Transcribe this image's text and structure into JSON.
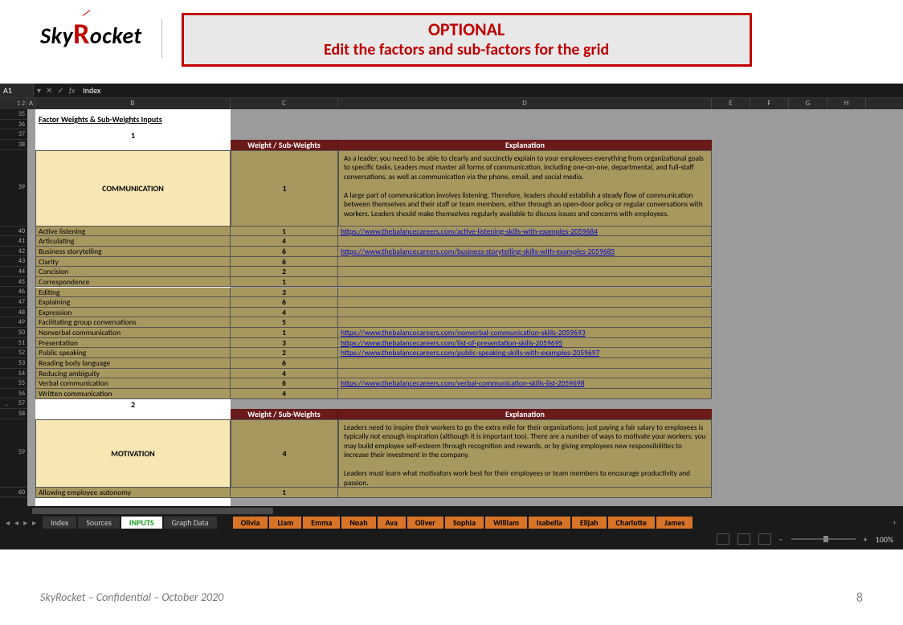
{
  "brand": "SkyRocket",
  "banner": {
    "line1": "OPTIONAL",
    "line2": "Edit the factors and sub-factors for the grid"
  },
  "excel": {
    "cellref": "A1",
    "fx_value": "Index",
    "cols": [
      "A",
      "B",
      "C",
      "D",
      "E",
      "F",
      "G",
      "H"
    ],
    "row_start": 35,
    "section_title": "Factor Weights & Sub-Weights Inputs",
    "header_weight": "Weight / Sub-Weights",
    "header_explain": "Explanation",
    "sections": [
      {
        "num": "1",
        "name": "COMMUNICATION",
        "weight": "1",
        "explain": "As a leader, you need to be able to clearly and succinctly explain to your employees everything from organizational goals to specific tasks. Leaders must master all forms of communication, including one-on-one, departmental, and full-staff conversations, as well as communication via the phone, email, and social media.\n\nA large part of communication involves listening. Therefore, leaders should establish a steady flow of communication between themselves and their staff or team members, either through an open-door policy or regular conversations with workers. Leaders should make themselves regularly available to discuss issues and concerns with employees.",
        "rows": [
          {
            "r": 40,
            "label": "Active listening",
            "w": "1",
            "link": "https://www.thebalancecareers.com/active-listening-skills-with-examples-2059684"
          },
          {
            "r": 41,
            "label": "Articulating",
            "w": "4",
            "link": ""
          },
          {
            "r": 42,
            "label": "Business storytelling",
            "w": "6",
            "link": "https://www.thebalancecareers.com/business-storytelling-skills-with-examples-2059685"
          },
          {
            "r": 43,
            "label": "Clarity",
            "w": "6",
            "link": ""
          },
          {
            "r": 44,
            "label": "Concision",
            "w": "2",
            "link": ""
          },
          {
            "r": 45,
            "label": "Correspondence",
            "w": "1",
            "link": ""
          },
          {
            "r": 46,
            "label": "Editing",
            "w": "3",
            "link": ""
          },
          {
            "r": 47,
            "label": "Explaining",
            "w": "6",
            "link": ""
          },
          {
            "r": 48,
            "label": "Expression",
            "w": "4",
            "link": ""
          },
          {
            "r": 49,
            "label": "Facilitating group conversations",
            "w": "5",
            "link": ""
          },
          {
            "r": 50,
            "label": "Nonverbal communication",
            "w": "1",
            "link": "https://www.thebalancecareers.com/nonverbal-communication-skills-2059693"
          },
          {
            "r": 51,
            "label": "Presentation",
            "w": "3",
            "link": "https://www.thebalancecareers.com/list-of-presentation-skills-2059695"
          },
          {
            "r": 52,
            "label": "Public speaking",
            "w": "2",
            "link": "https://www.thebalancecareers.com/public-speaking-skills-with-examples-2059697"
          },
          {
            "r": 53,
            "label": "Reading body language",
            "w": "6",
            "link": ""
          },
          {
            "r": 54,
            "label": "Reducing ambiguity",
            "w": "4",
            "link": ""
          },
          {
            "r": 55,
            "label": "Verbal communication",
            "w": "6",
            "link": "https://www.thebalancecareers.com/verbal-communication-skills-list-2059698"
          },
          {
            "r": 56,
            "label": "Written communication",
            "w": "4",
            "link": ""
          }
        ]
      },
      {
        "num": "2",
        "name": "MOTIVATION",
        "weight": "4",
        "explain": "Leaders need to inspire their workers to go the extra mile for their organizations; just paying a fair salary to employees is typically not enough inspiration (although it is important too). There are a number of ways to motivate your workers: you may build employee self-esteem through recognition and rewards, or by giving employees new responsibilities to increase their investment in the company.\n\nLeaders must learn what motivators work best for their employees or team members to encourage productivity and passion.",
        "rows": [
          {
            "r": 60,
            "label": "Allowing employee autonomy",
            "w": "1",
            "link": ""
          }
        ]
      }
    ],
    "sheet_tabs": {
      "nav": [
        "Index",
        "Sources"
      ],
      "active": "INPUTS",
      "after_active": [
        "Graph Data"
      ],
      "orange": [
        "Olivia",
        "Liam",
        "Emma",
        "Noah",
        "Ava",
        "Oliver",
        "Sophia",
        "William",
        "Isabella",
        "Elijah",
        "Charlotte",
        "James"
      ]
    },
    "zoom": "100%"
  },
  "footer": {
    "left": "SkyRocket – Confidential – October 2020",
    "page": "8"
  }
}
